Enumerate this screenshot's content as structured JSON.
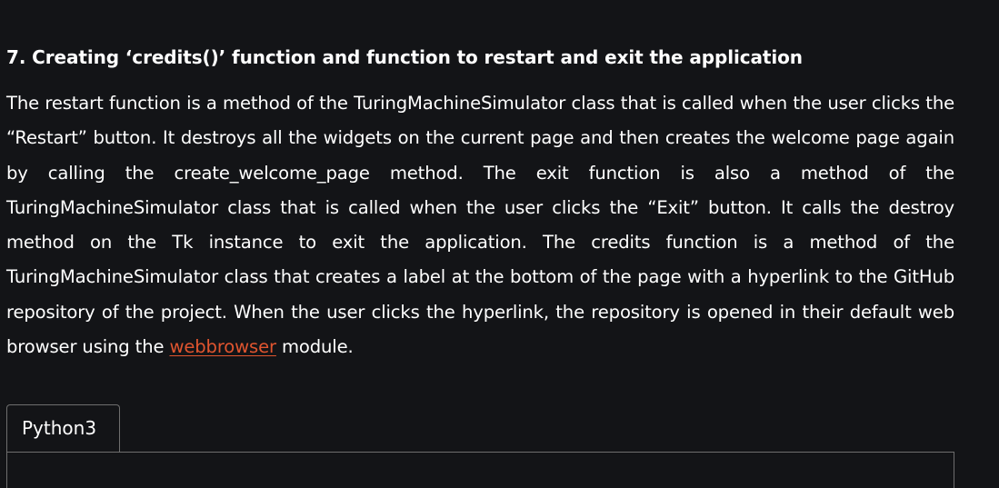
{
  "article": {
    "heading": "7. Creating ‘credits()’ function and function to restart and exit the application",
    "paragraph_before_link": "The restart function is a method of the TuringMachineSimulator class that is called when the user clicks the “Restart” button. It destroys all the widgets on the current page and then creates the welcome page again by calling the create_welcome_page method. The exit function is also a method of the TuringMachineSimulator class that is called when the user clicks the “Exit” button. It calls the destroy method on the Tk instance to exit the application. The credits function is a method of the TuringMachineSimulator class that creates a label at the bottom of the page with a hyperlink to the GitHub repository of the project. When the user clicks the hyperlink, the repository is opened in their default web browser using the ",
    "link_text": "webbrowser",
    "paragraph_after_link": " module."
  },
  "code_block": {
    "tab_label": "Python3"
  },
  "colors": {
    "background": "#131417",
    "text": "#ffffff",
    "link": "#e0552f",
    "border": "#6e6e6e"
  }
}
